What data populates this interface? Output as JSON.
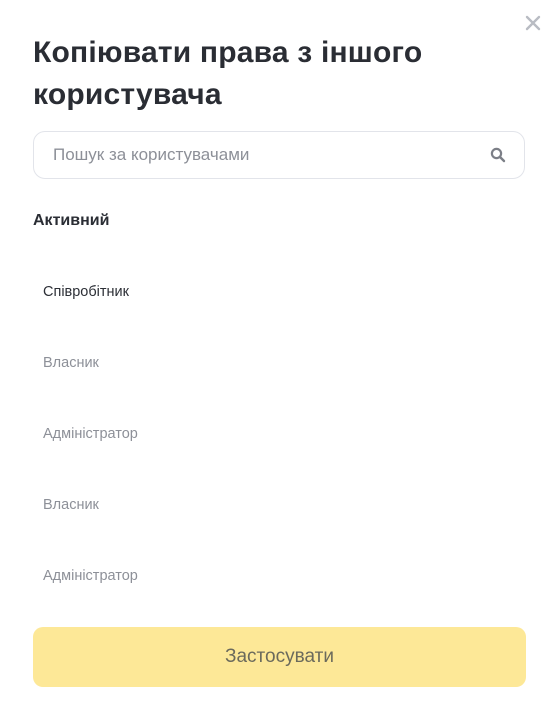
{
  "dialog": {
    "title": "Копіювати права з іншого користувача",
    "close_icon": "close-icon"
  },
  "search": {
    "placeholder": "Пошук за користувачами",
    "value": "",
    "icon": "search-icon"
  },
  "section": {
    "heading": "Активний"
  },
  "users": [
    {
      "label": "Співробітник",
      "active": true
    },
    {
      "label": "Власник",
      "active": false
    },
    {
      "label": "Адміністратор",
      "active": false
    },
    {
      "label": "Власник",
      "active": false
    },
    {
      "label": "Адміністратор",
      "active": false
    }
  ],
  "footer": {
    "apply_label": "Застосувати"
  },
  "colors": {
    "apply_button_bg": "#fde897",
    "text_primary": "#2a2d34",
    "text_muted": "#8d9098",
    "border": "#e2e4ea"
  }
}
